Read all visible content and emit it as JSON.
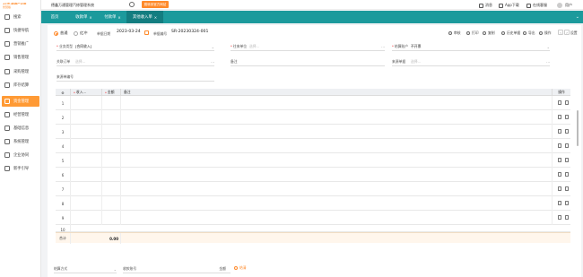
{
  "brand": {
    "logo_line1": "4S店/维修厂必用",
    "logo_line2": "智慧版",
    "system_title": "德鑫万通管理汽修管理系统",
    "promo_label": "跳转到官方网站"
  },
  "sidebar": {
    "items": [
      {
        "label": "搜索",
        "icon": "search-icon",
        "active": false
      },
      {
        "label": "快捷导航",
        "icon": "shortcut-icon",
        "active": false
      },
      {
        "label": "营销推广",
        "icon": "marketing-icon",
        "active": false
      },
      {
        "label": "销售管理",
        "icon": "sales-icon",
        "active": false
      },
      {
        "label": "采购管理",
        "icon": "purchase-icon",
        "active": false
      },
      {
        "label": "库存结算",
        "icon": "inventory-icon",
        "active": false
      },
      {
        "label": "资金管理",
        "icon": "finance-icon",
        "active": true
      },
      {
        "label": "经营管理",
        "icon": "business-icon",
        "active": false
      },
      {
        "label": "基础信息",
        "icon": "info-icon",
        "active": false
      },
      {
        "label": "系统管理",
        "icon": "system-icon",
        "active": false
      },
      {
        "label": "企业协同",
        "icon": "collab-icon",
        "active": false
      },
      {
        "label": "新手引导",
        "icon": "guide-icon",
        "active": false
      }
    ]
  },
  "topbar": {
    "notice": "消息",
    "app_download": "App下载",
    "online_service": "在线客服",
    "user": "用户"
  },
  "tabs": [
    {
      "label": "首页",
      "closable": false,
      "active": false
    },
    {
      "label": "收款单",
      "closable": true,
      "active": false
    },
    {
      "label": "付款单",
      "closable": true,
      "active": false
    },
    {
      "label": "其他收入单",
      "closable": true,
      "active": true
    }
  ],
  "form": {
    "radio_normal": "普通",
    "radio_red": "红冲",
    "date_label": "单据日期",
    "date_value": "2023-03-24",
    "doc_no_label": "单据编号",
    "doc_no_value": "SR-20230324-001",
    "fields": {
      "business_type_label": "业务类型",
      "business_type_value": "[合同收入]",
      "unit_label": "往来单位",
      "unit_placeholder": "选择...",
      "settle_account_label": "结算账户",
      "settle_account_value": "不开票",
      "related_order_label": "关联订单",
      "related_order_placeholder": "选择...",
      "remark_label": "备注",
      "source_label": "来源单据",
      "source_placeholder": "选择...",
      "source_no_label": "来源单编号"
    }
  },
  "toolbar": {
    "audit": "审核",
    "print": "打印",
    "copy": "复制",
    "history": "历史单据",
    "export": "导出",
    "more": "操作",
    "settings": "设置"
  },
  "table": {
    "headers": [
      "收入...",
      "金额",
      "备注",
      "操作"
    ],
    "rows": [
      "1",
      "2",
      "3",
      "4",
      "5",
      "6",
      "7",
      "8",
      "9",
      "10"
    ],
    "total_label": "合计",
    "total_amount": "0.00"
  },
  "bottom": {
    "payment_method_label": "结算方式",
    "payment_account_label": "收款账号",
    "amount_label": "金额",
    "settle_label": "结清"
  }
}
